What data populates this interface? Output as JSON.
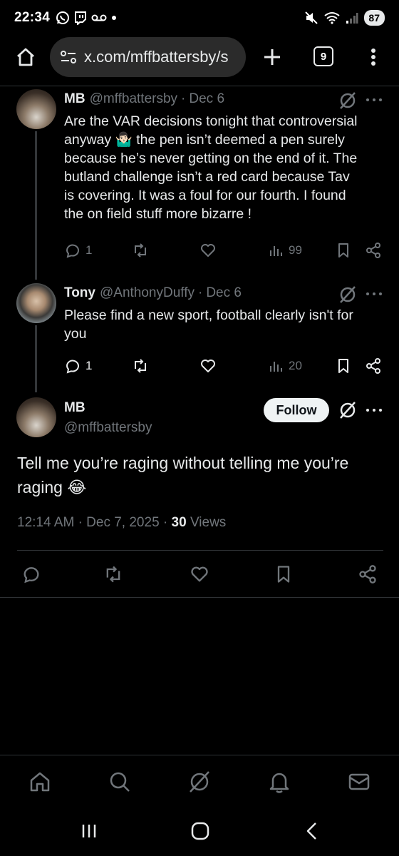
{
  "status_bar": {
    "time": "22:34",
    "battery": "87"
  },
  "browser": {
    "url": "x.com/mffbattersby/s",
    "tab_count": "9"
  },
  "tweets": [
    {
      "name": "MB",
      "handle": "@mffbattersby",
      "date": "Dec 6",
      "lines": [
        "Are the VAR decisions tonight that controversial",
        "anyway 🤷🏻‍♂️ the pen isn’t deemed a pen surely",
        "because he’s never getting on the end of it. The",
        "butland challenge isn’t a red card because Tav",
        "is covering. It was a foul for our fourth. I found",
        "the on field stuff more bizarre !"
      ],
      "replies": "1",
      "views": "99"
    },
    {
      "name": "Tony",
      "handle": "@AnthonyDuffy",
      "date": "Dec 6",
      "lines": [
        "Please find a new sport, football clearly isn't for",
        "you"
      ],
      "replies": "1",
      "views": "20"
    }
  ],
  "main_tweet": {
    "name": "MB",
    "handle": "@mffbattersby",
    "follow_label": "Follow",
    "lines": [
      "Tell me you’re raging without telling me you’re",
      "raging 😂"
    ],
    "time": "12:14 AM",
    "date": "Dec 7, 2025",
    "views_count": "30",
    "views_label": "Views"
  }
}
